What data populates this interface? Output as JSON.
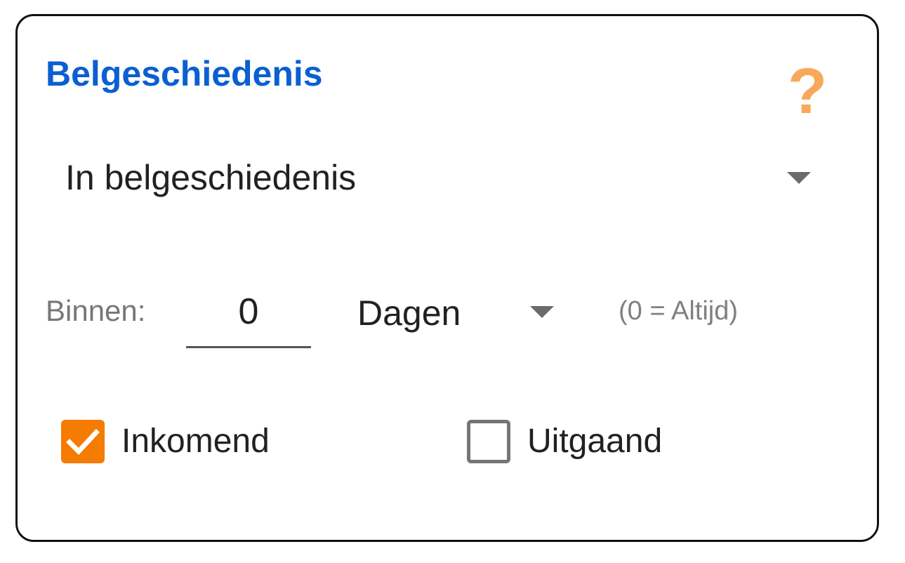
{
  "card": {
    "title": "Belgeschiedenis",
    "help_glyph": "?"
  },
  "history_select": {
    "selected": "In belgeschiedenis"
  },
  "within": {
    "label": "Binnen:",
    "value": "0",
    "unit": "Dagen",
    "hint": "(0 = Altijd)"
  },
  "direction": {
    "incoming": {
      "label": "Inkomend",
      "checked": true
    },
    "outgoing": {
      "label": "Uitgaand",
      "checked": false
    }
  },
  "colors": {
    "title": "#0a5fd1",
    "help_icon": "#f7a85a",
    "checkbox_checked": "#f57c00"
  },
  "icons": {
    "help": "question-mark-icon",
    "dropdown": "triangle-down-icon",
    "check": "checkmark-icon"
  }
}
